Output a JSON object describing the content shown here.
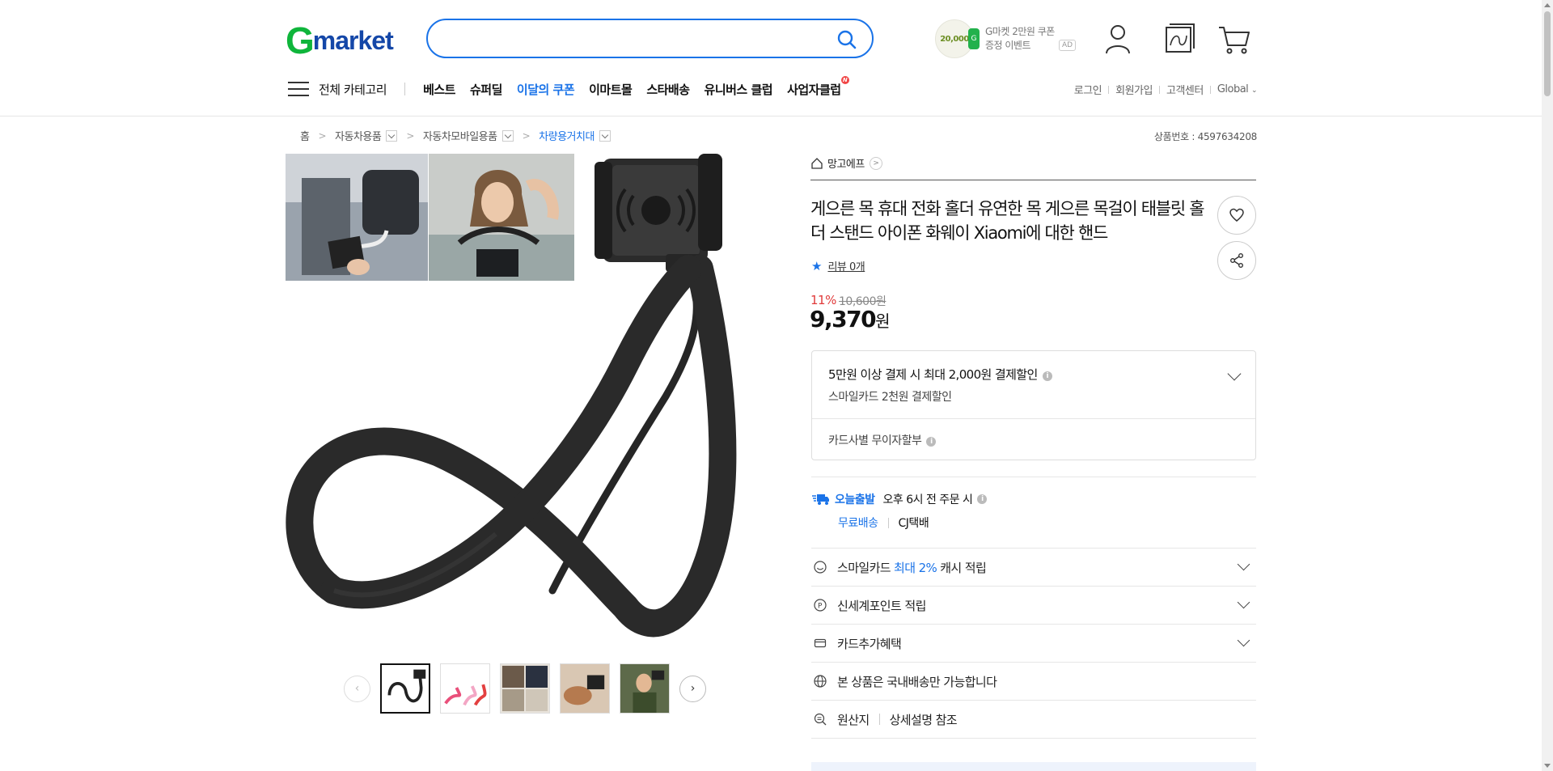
{
  "header": {
    "logo_g": "G",
    "logo_rest": "market",
    "search_placeholder": "",
    "promo_amount": "20,000",
    "promo_chip": "G",
    "promo_line1": "G마켓 2만원 쿠폰",
    "promo_line2": "증정 이벤트",
    "ad": "AD"
  },
  "nav": {
    "all_categories": "전체 카테고리",
    "items": [
      "베스트",
      "슈퍼딜",
      "이달의 쿠폰",
      "이마트몰",
      "스타배송",
      "유니버스 클럽",
      "사업자클럽"
    ],
    "new_badge": "N",
    "util": [
      "로그인",
      "회원가입",
      "고객센터",
      "Global"
    ]
  },
  "breadcrumb": {
    "items": [
      "홈",
      "자동차용품",
      "자동차모바일용품",
      "차량용거치대"
    ],
    "product_no": "상품번호 : 4597634208"
  },
  "product": {
    "seller": "망고에프",
    "title": "게으른 목 휴대 전화 홀더 유연한 목 게으른 목걸이 태블릿 홀더 스탠드 아이폰 화웨이 Xiaomi에 대한 핸드",
    "review": "리뷰 0개",
    "discount": "11%",
    "original_price": "10,600원",
    "price": "9,370",
    "price_unit": "원"
  },
  "benefits": {
    "line1": "5만원 이상 결제 시 최대 2,000원 결제할인",
    "line2": "스마일카드 2천원 결제할인",
    "line3": "카드사별 무이자할부"
  },
  "shipping": {
    "today": "오늘출발",
    "cutoff": "오후 6시 전 주문 시",
    "free": "무료배송",
    "carrier": "CJ택배"
  },
  "rows": {
    "smile_pre": "스마일카드",
    "smile_blue": "최대 2%",
    "smile_post": "캐시 적립",
    "shinsegae": "신세계포인트 적립",
    "card_extra": "카드추가혜택",
    "domestic": "본 상품은 국내배송만 가능합니다",
    "origin_label": "원산지",
    "origin_value": "상세설명 참조"
  },
  "colors": {
    "brand_green": "#0fb53b",
    "brand_blue": "#1447a8",
    "accent": "#1a73e8",
    "discount_red": "#e03a3a"
  }
}
